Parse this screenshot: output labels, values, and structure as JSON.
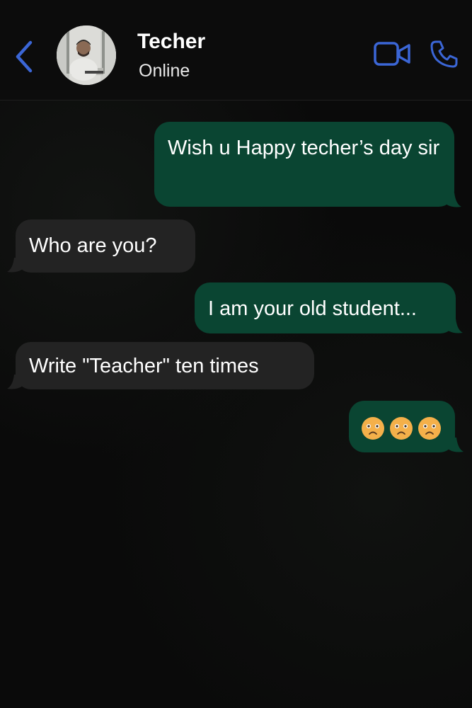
{
  "contact": {
    "name": "Techer",
    "status": "Online"
  },
  "icons": {
    "back": "chevron-left-icon",
    "video": "video-camera-icon",
    "call": "phone-icon",
    "emoji": "worried-face-emoji"
  },
  "colors": {
    "accent": "#3b66d6",
    "outgoing_bubble": "#0a4532",
    "incoming_bubble": "#232323",
    "emoji": "#f4b04a"
  },
  "messages": [
    {
      "direction": "outgoing",
      "text": "Wish u Happy techer’s day sir"
    },
    {
      "direction": "incoming",
      "text": "Who are you?"
    },
    {
      "direction": "outgoing",
      "text": "I am your old student..."
    },
    {
      "direction": "incoming",
      "text": "Write \"Teacher\" ten times"
    },
    {
      "direction": "outgoing",
      "emoji": [
        "worried-face",
        "worried-face",
        "worried-face"
      ]
    }
  ]
}
